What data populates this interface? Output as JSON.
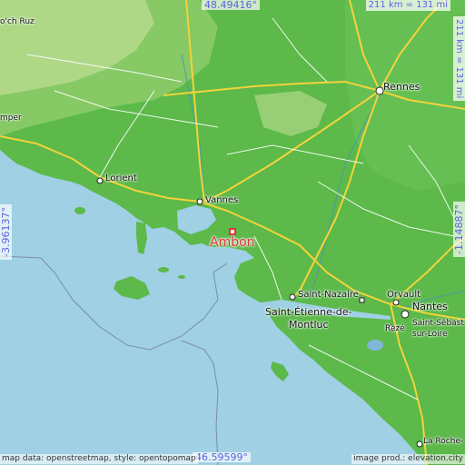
{
  "coords": {
    "top_latitude": "48.49416°",
    "bottom_latitude": "46.59599°",
    "left_longitude": "-3.96137°",
    "right_longitude": "-1.14887°"
  },
  "distances": {
    "horizontal": "211 km = 131 mi",
    "vertical": "211 km = 131 mi"
  },
  "places": {
    "ambon": "Ambon",
    "rennes": "Rennes",
    "vannes": "Vannes",
    "lorient": "Lorient",
    "saint_nazaire": "Saint-Nazaire",
    "saint_etienne_line1": "Saint-Étienne-de-",
    "saint_etienne_line2": "Montluc",
    "orvault": "Orvault",
    "nantes": "Nantes",
    "saint_sebastien_line1": "Saint-Sébast",
    "saint_sebastien_line2": "sur-Loire",
    "reze": "Rezé",
    "la_roche": "La Roche-",
    "quimper_partial": "mper",
    "roc_partial": "o'ch Ruz"
  },
  "credits": {
    "map_data": "map data: openstreetmap, style: opentopomap",
    "image_prod": "image prod.: elevation.city"
  },
  "colors": {
    "sea": "#9fd0e3",
    "lowland": "#5cb94a",
    "upland": "#9fd27a",
    "highland": "#c9e2a0",
    "road_major": "#f3d33a",
    "road_minor": "#ffffff",
    "marker": "#e0323c",
    "coord_text": "#5a63e0"
  }
}
